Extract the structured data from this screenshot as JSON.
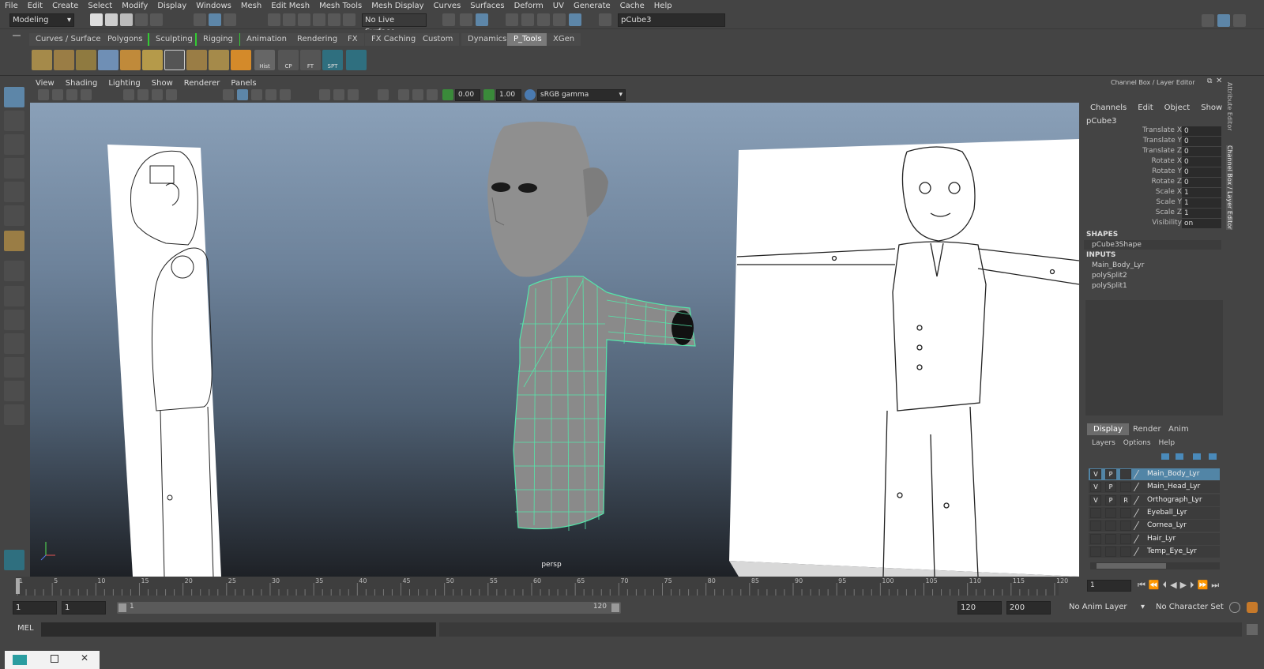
{
  "menubar": [
    "File",
    "Edit",
    "Create",
    "Select",
    "Modify",
    "Display",
    "Windows",
    "Mesh",
    "Edit Mesh",
    "Mesh Tools",
    "Mesh Display",
    "Curves",
    "Surfaces",
    "Deform",
    "UV",
    "Generate",
    "Cache",
    "Help"
  ],
  "status": {
    "mode": "Modeling",
    "live_surface": "No Live Surface",
    "object_field": "pCube3"
  },
  "shelf_tabs": [
    "Curves / Surfaces",
    "Polygons",
    "Sculpting",
    "Rigging",
    "Animation",
    "Rendering",
    "FX",
    "FX Caching",
    "Custom",
    "Dynamics",
    "P_Tools",
    "XGen"
  ],
  "shelf_active": "P_Tools",
  "shelf_labels": {
    "hist": "Hist",
    "cp": "CP",
    "ft": "FT",
    "spt": "SPT"
  },
  "viewport": {
    "menu": [
      "View",
      "Shading",
      "Lighting",
      "Show",
      "Renderer",
      "Panels"
    ],
    "exposure": "0.00",
    "gamma": "1.00",
    "colorspace": "sRGB gamma",
    "camera": "persp"
  },
  "channel_box": {
    "title": "Channel Box / Layer Editor",
    "menu": [
      "Channels",
      "Edit",
      "Object",
      "Show"
    ],
    "object": "pCube3",
    "attributes": [
      {
        "name": "Translate X",
        "value": "0"
      },
      {
        "name": "Translate Y",
        "value": "0"
      },
      {
        "name": "Translate Z",
        "value": "0"
      },
      {
        "name": "Rotate X",
        "value": "0"
      },
      {
        "name": "Rotate Y",
        "value": "0"
      },
      {
        "name": "Rotate Z",
        "value": "0"
      },
      {
        "name": "Scale X",
        "value": "1"
      },
      {
        "name": "Scale Y",
        "value": "1"
      },
      {
        "name": "Scale Z",
        "value": "1"
      },
      {
        "name": "Visibility",
        "value": "on"
      }
    ],
    "shapes_header": "SHAPES",
    "shape": "pCube3Shape",
    "inputs_header": "INPUTS",
    "inputs": [
      "Main_Body_Lyr",
      "polySplit2",
      "polySplit1"
    ]
  },
  "side_tabs": [
    "Attribute Editor",
    "Channel Box / Layer Editor"
  ],
  "layer_editor": {
    "tabs": [
      "Display",
      "Render",
      "Anim"
    ],
    "menu": [
      "Layers",
      "Options",
      "Help"
    ],
    "layers": [
      {
        "v": "V",
        "p": "P",
        "r": "",
        "name": "Main_Body_Lyr",
        "selected": true
      },
      {
        "v": "V",
        "p": "P",
        "r": "",
        "name": "Main_Head_Lyr",
        "selected": false
      },
      {
        "v": "V",
        "p": "P",
        "r": "R",
        "name": "Orthograph_Lyr",
        "selected": false
      },
      {
        "v": "",
        "p": "",
        "r": "",
        "name": "Eyeball_Lyr",
        "selected": false
      },
      {
        "v": "",
        "p": "",
        "r": "",
        "name": "Cornea_Lyr",
        "selected": false
      },
      {
        "v": "",
        "p": "",
        "r": "",
        "name": "Hair_Lyr",
        "selected": false
      },
      {
        "v": "",
        "p": "",
        "r": "",
        "name": "Temp_Eye_Lyr",
        "selected": false
      }
    ]
  },
  "timeline": {
    "ticks": [
      "1",
      "5",
      "10",
      "15",
      "20",
      "25",
      "30",
      "35",
      "40",
      "45",
      "50",
      "55",
      "60",
      "65",
      "70",
      "75",
      "80",
      "85",
      "90",
      "95",
      "100",
      "105",
      "110",
      "115",
      "120"
    ],
    "current": "1"
  },
  "range": {
    "start": "1",
    "inner_start": "1",
    "slider_start": "1",
    "slider_end": "120",
    "end": "120",
    "anim_end": "200",
    "anim_layer": "No Anim Layer",
    "char_set": "No Character Set"
  },
  "command": {
    "lang": "MEL"
  }
}
